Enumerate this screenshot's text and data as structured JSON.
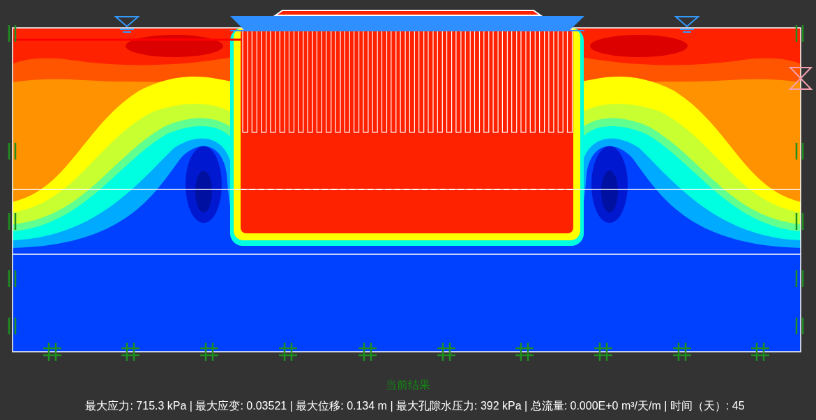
{
  "result_label": "当前结果",
  "status": "最大应力: 715.3 kPa | 最大应变: 0.03521 | 最大位移: 0.134 m | 最大孔隙水压力: 392 kPa | 总流量: 0.000E+0 m³/天/m | 时间（天）: 45"
}
